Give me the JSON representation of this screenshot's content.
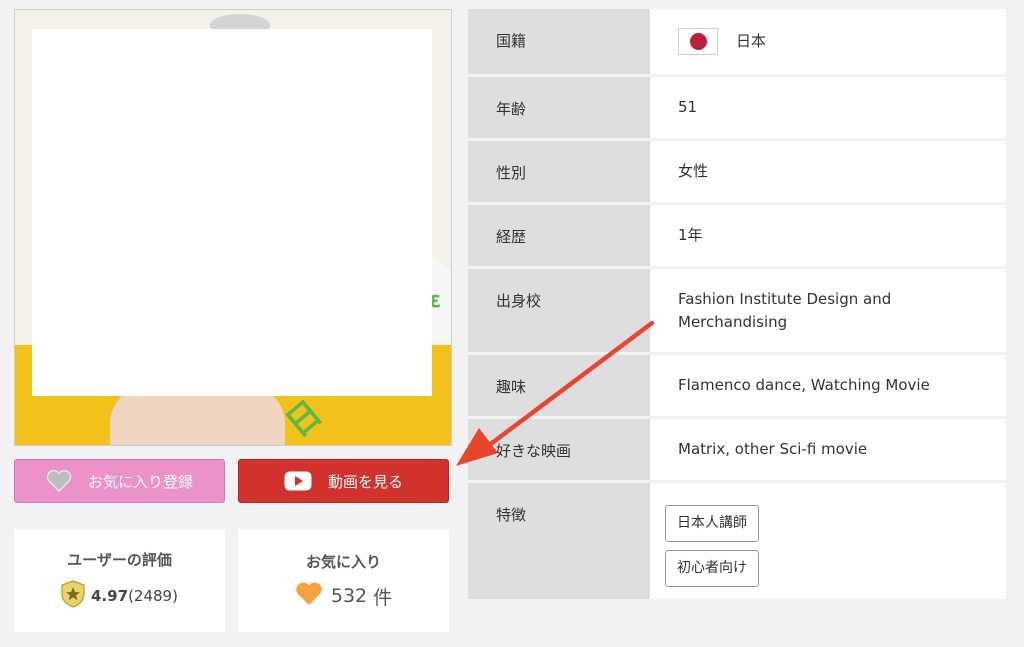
{
  "favorite_button": {
    "label": "お気に入り登録",
    "icon": "heart-outline-icon"
  },
  "video_button": {
    "label": "動画を見る",
    "icon": "play-icon"
  },
  "rating_card": {
    "title": "ユーザーの評価",
    "score": "4.97",
    "count": "(2489)",
    "icon": "star-shield-icon"
  },
  "favorites_card": {
    "title": "お気に入り",
    "count": "532",
    "unit": "件",
    "icon": "heart-icon"
  },
  "photo": {
    "banner_text": "日"
  },
  "profile": {
    "nationality": {
      "label": "国籍",
      "value": "日本",
      "flag": "japan-flag-icon"
    },
    "age": {
      "label": "年齢",
      "value": "51"
    },
    "gender": {
      "label": "性別",
      "value": "女性"
    },
    "experience": {
      "label": "経歴",
      "value": "1年"
    },
    "school": {
      "label": "出身校",
      "value": "Fashion Institute Design and Merchandising"
    },
    "hobbies": {
      "label": "趣味",
      "value": "Flamenco dance, Watching Movie"
    },
    "favorite_movies": {
      "label": "好きな映画",
      "value": "Matrix, other Sci-fi movie"
    },
    "features": {
      "label": "特徴",
      "tags": [
        "日本人講師",
        "初心者向け"
      ]
    }
  },
  "colors": {
    "favorite_button": "#ec92c8",
    "video_button": "#d2322d",
    "annotation_arrow": "#e8452c",
    "flag_red": "#bc1f3a"
  }
}
